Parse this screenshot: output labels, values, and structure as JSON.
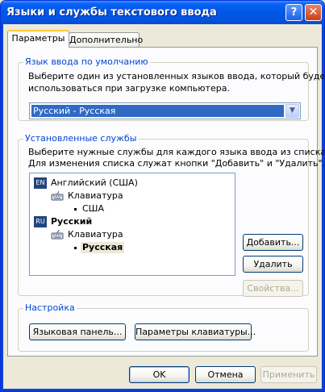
{
  "window": {
    "title": "Языки и службы текстового ввода",
    "help_symbol": "?",
    "close_symbol": "✕"
  },
  "tabs": [
    {
      "label": "Параметры",
      "active": true
    },
    {
      "label": "Дополнительно",
      "active": false
    }
  ],
  "default_language": {
    "group_label": "Язык ввода по умолчанию",
    "description_line1": "Выберите один из установленных языков ввода, который будет",
    "description_line2": "использоваться при загрузке компьютера.",
    "selected": "Русский - Русская",
    "arrow_icon": "chevron-down-icon"
  },
  "installed_services": {
    "group_label": "Установленные службы",
    "description_line1": "Выберите нужные службы для каждого языка ввода из списка.",
    "description_line2": "Для изменения списка служат кнопки \"Добавить\" и \"Удалить\".",
    "tree": [
      {
        "badge": "EN",
        "language": "Английский (США)",
        "category": "Клавиатура",
        "layout": "США",
        "bold": false
      },
      {
        "badge": "RU",
        "language": "Русский",
        "category": "Клавиатура",
        "layout": "Русская",
        "bold": true
      }
    ],
    "buttons": {
      "add": "Добавить...",
      "remove": "Удалить",
      "properties": "Свойства..."
    }
  },
  "settings": {
    "group_label": "Настройка",
    "language_bar_button": "Языковая панель...",
    "keyboard_settings_button": "Параметры клавиатуры..."
  },
  "dialog_buttons": {
    "ok": "OK",
    "cancel": "Отмена",
    "apply": "Применить"
  },
  "colors": {
    "titlebar": "#0058e6",
    "group_label": "#0046d5",
    "selection": "#316ac5",
    "language_badge": "#21457e"
  }
}
